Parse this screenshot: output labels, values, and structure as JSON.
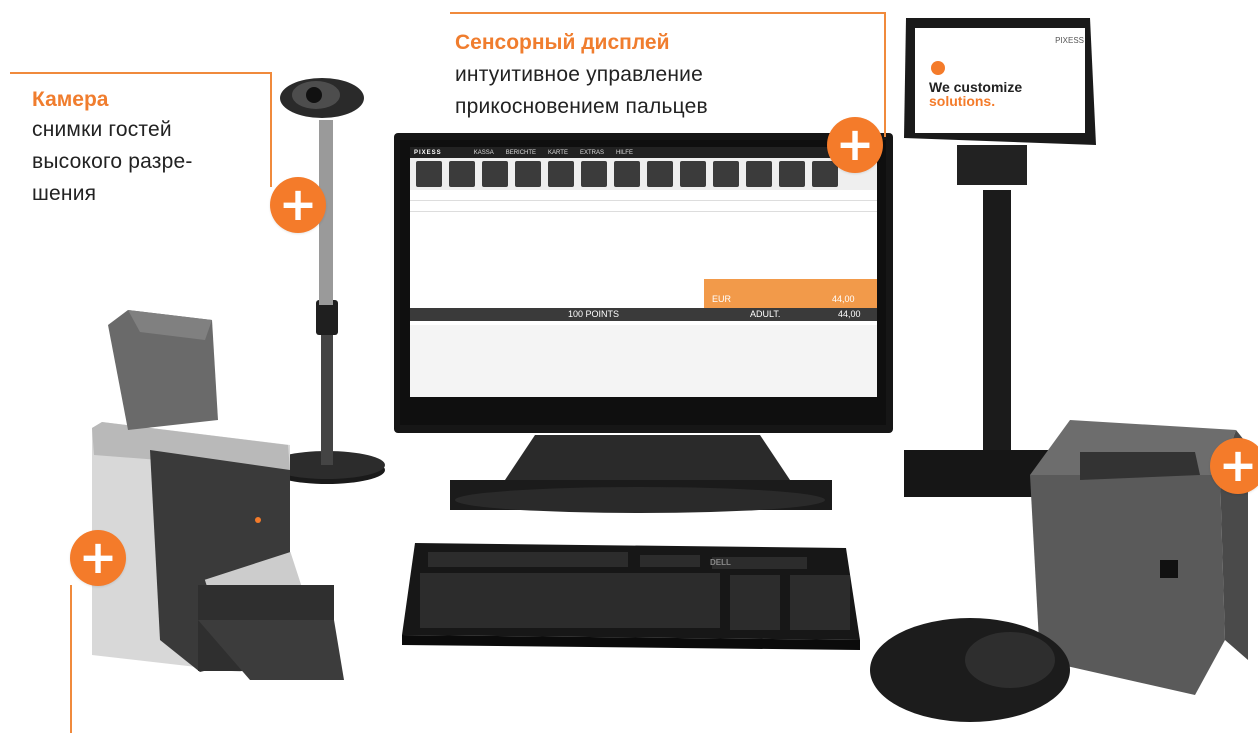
{
  "callouts": {
    "camera": {
      "title": "Камера",
      "lines": [
        "снимки гостей",
        "высокого разре-",
        "шения"
      ]
    },
    "display": {
      "title": "Сенсорный дисплей",
      "lines": [
        "интуитивное управление",
        "прикосновением пальцев"
      ]
    }
  },
  "plus_symbol": "+",
  "devices": {
    "customer_display": {
      "brand": "PIXESS",
      "text_line1": "We customize",
      "text_line2": "solutions."
    },
    "pos_screen": {
      "menu": [
        "PIXESS",
        "KASSA",
        "BERICHTE",
        "KARTE",
        "EXTRAS",
        "HILFE"
      ],
      "points_label": "100 POINTS",
      "currency": "EUR",
      "amount": "44,00",
      "ticket": "ADULT.",
      "total": "44,00"
    },
    "keyboard_brand": "DELL"
  },
  "colors": {
    "accent": "#f47b2a",
    "line": "#f08a3c",
    "text": "#222222"
  }
}
